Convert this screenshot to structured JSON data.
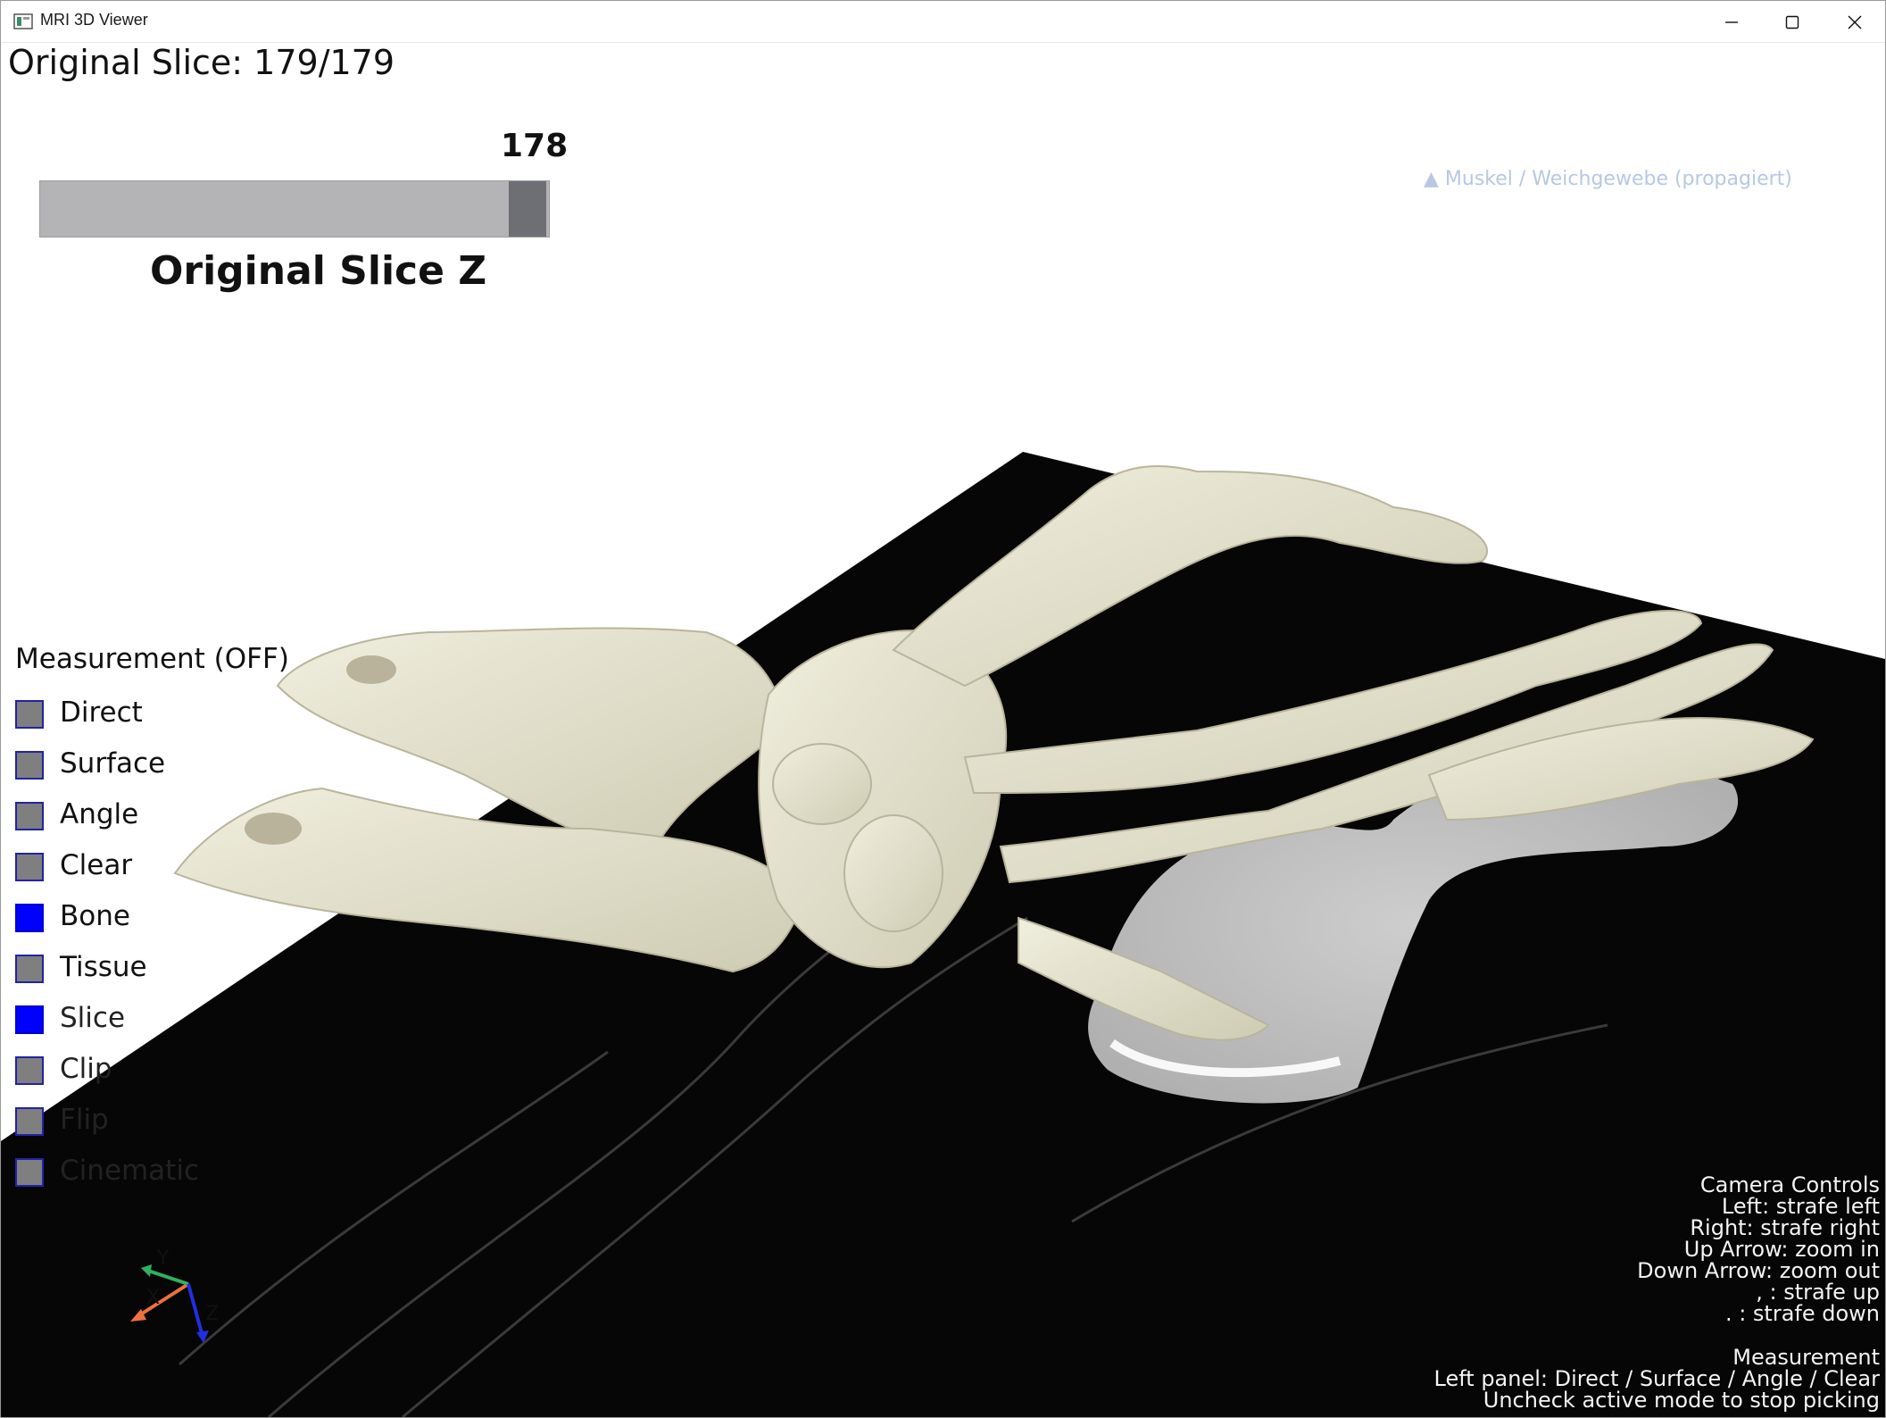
{
  "window": {
    "title": "MRI 3D Viewer",
    "buttons": [
      "minimize",
      "maximize",
      "close"
    ]
  },
  "overlay": {
    "slice_info": "Original Slice: 179/179",
    "slider": {
      "value_label": "178",
      "title": "Original Slice Z",
      "value": 178,
      "max": 179
    },
    "legend": "▲ Muskel / Weichgewebe (propagiert)"
  },
  "measurement": {
    "title": "Measurement (OFF)",
    "options": [
      {
        "label": "Direct",
        "checked": false
      },
      {
        "label": "Surface",
        "checked": false
      },
      {
        "label": "Angle",
        "checked": false
      },
      {
        "label": "Clear",
        "checked": false
      },
      {
        "label": "Bone",
        "checked": true
      },
      {
        "label": "Tissue",
        "checked": false
      },
      {
        "label": "Slice",
        "checked": true
      },
      {
        "label": "Clip",
        "checked": false
      },
      {
        "label": "Flip",
        "checked": false
      },
      {
        "label": "Cinematic",
        "checked": false
      }
    ]
  },
  "camera_help": {
    "title": "Camera Controls",
    "lines": [
      "Left: strafe left",
      "Right: strafe right",
      "Up Arrow: zoom in",
      "Down Arrow: zoom out",
      ", : strafe up",
      ". : strafe down"
    ]
  },
  "measurement_help": {
    "title": "Measurement",
    "lines": [
      "Left panel: Direct / Surface / Angle / Clear",
      "Uncheck active mode to stop picking"
    ]
  },
  "axes": {
    "x": "X",
    "y": "Y",
    "z": "Z"
  },
  "colors": {
    "bone": "#e3e1cc",
    "slice_bg": "#050505",
    "checkbox_on": "#0000ff",
    "checkbox_off": "#7f7f7f",
    "slider_handle": "#6d6f75",
    "axis_x": "#f07040",
    "axis_y": "#30b060",
    "axis_z": "#2030e0"
  }
}
